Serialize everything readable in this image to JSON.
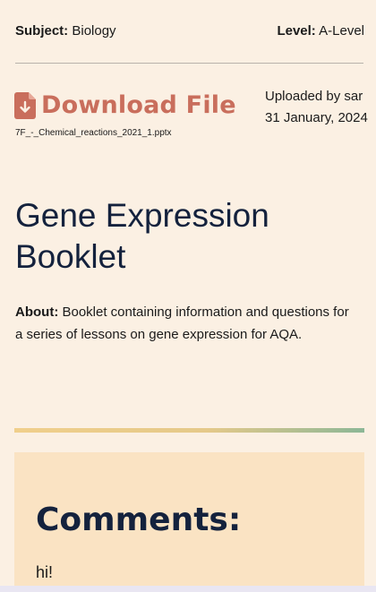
{
  "meta": {
    "subject_label": "Subject:",
    "subject_value": "Biology",
    "level_label": "Level:",
    "level_value": "A-Level"
  },
  "download": {
    "icon": "file-download-icon",
    "label": "Download File",
    "filename": "7F_-_Chemical_reactions_2021_1.pptx"
  },
  "upload": {
    "uploaded_by": "Uploaded by sar",
    "date": "31 January, 2024"
  },
  "resource": {
    "title": "Gene Expression Booklet",
    "about_label": "About:",
    "about_text": "Booklet containing information and questions for a series of lessons on gene expression for AQA."
  },
  "comments": {
    "heading": "Comments:",
    "items": [
      {
        "text": "hi!"
      }
    ]
  },
  "colors": {
    "background": "#fbf0e3",
    "accent": "#c96e5c",
    "title": "#14223d",
    "comments_bg": "#fae3c3"
  }
}
